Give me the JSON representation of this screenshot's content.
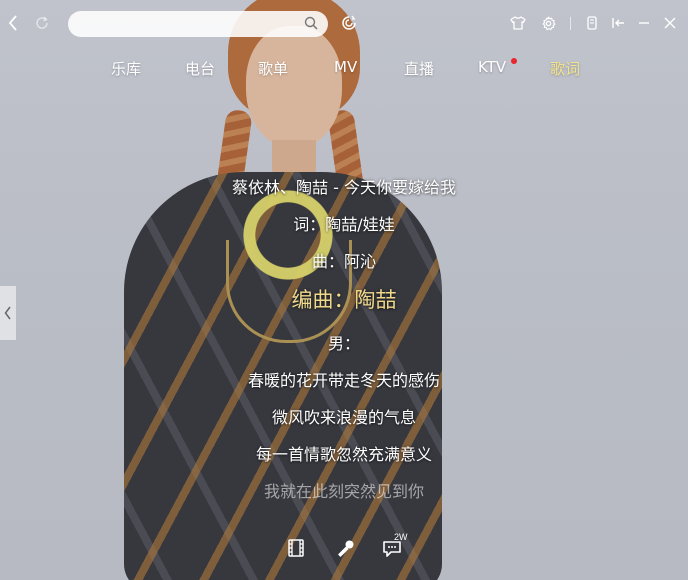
{
  "search": {
    "value": "",
    "placeholder": ""
  },
  "icons": {
    "back": "chevron-left-icon",
    "refresh": "refresh-icon",
    "search": "search-icon",
    "song_recognition": "song-recognition-icon",
    "skin": "tshirt-icon",
    "settings": "gear-icon",
    "mini_mode": "mini-mode-icon",
    "shrink": "shrink-to-bar-icon",
    "minimize": "minimize-icon",
    "close": "close-icon",
    "side_handle": "chevron-left-icon",
    "mv": "film-icon",
    "karaoke": "microphone-icon",
    "comments": "comment-icon"
  },
  "tabs": [
    {
      "label": "乐库"
    },
    {
      "label": "电台"
    },
    {
      "label": "歌单"
    },
    {
      "label": "MV"
    },
    {
      "label": "直播"
    },
    {
      "label": "KTV"
    },
    {
      "label": "歌词"
    }
  ],
  "active_tab": "歌词",
  "lyrics": {
    "lines": [
      "蔡依林、陶喆 - 今天你要嫁给我",
      "词：陶喆/娃娃",
      "曲：阿沁",
      "编曲：陶喆",
      "男：",
      "春暖的花开带走冬天的感伤",
      "微风吹来浪漫的气息",
      "每一首情歌忽然充满意义",
      "我就在此刻突然见到你"
    ],
    "current_index": 3
  },
  "bottom": {
    "comments_count": "2W"
  },
  "colors": {
    "active_tab": "#f2e48a",
    "current_lyric": "#f0d98b",
    "notification_dot": "#e8262c"
  }
}
